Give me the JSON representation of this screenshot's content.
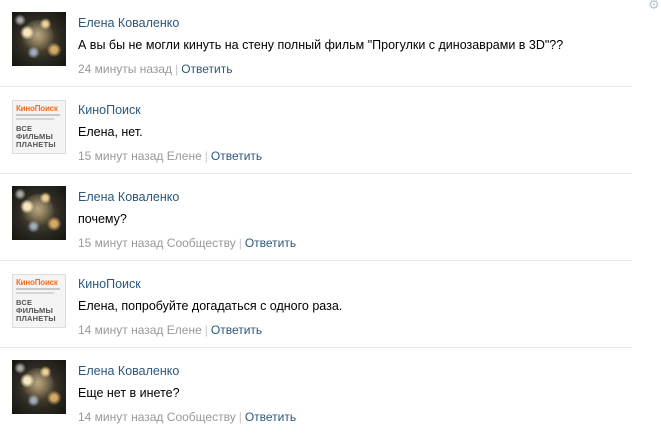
{
  "comments": [
    {
      "author": "Елена Коваленко",
      "avatar": "sparkle-photo",
      "text": "А вы бы не могли кинуть на стену полный фильм \"Прогулки с динозаврами в 3D\"??",
      "time": "24 минуты назад",
      "reply_to": "",
      "reply_label": "Ответить"
    },
    {
      "author": "КиноПоиск",
      "avatar": "kinopoisk-logo",
      "text": "Елена, нет.",
      "time": "15 минут назад",
      "reply_to": "Елене",
      "reply_label": "Ответить"
    },
    {
      "author": "Елена Коваленко",
      "avatar": "sparkle-photo",
      "text": "почему?",
      "time": "15 минут назад",
      "reply_to": "Сообществу",
      "reply_label": "Ответить"
    },
    {
      "author": "КиноПоиск",
      "avatar": "kinopoisk-logo",
      "text": "Елена, попробуйте догадаться с одного раза.",
      "time": "14 минут назад",
      "reply_to": "Елене",
      "reply_label": "Ответить"
    },
    {
      "author": "Елена Коваленко",
      "avatar": "sparkle-photo",
      "text": "Еще нет в инете?",
      "time": "14 минут назад",
      "reply_to": "Сообществу",
      "reply_label": "Ответить"
    }
  ],
  "kinopoisk_logo": {
    "brand": "КиноПоиск",
    "tagline": "ВСЕ ФИЛЬМЫ ПЛАНЕТЫ"
  },
  "colors": {
    "link": "#2b587a",
    "meta": "#999999",
    "divider": "#e7eaed",
    "brand_orange": "#f26f1f"
  },
  "icons": {
    "settings": "gear-icon"
  }
}
